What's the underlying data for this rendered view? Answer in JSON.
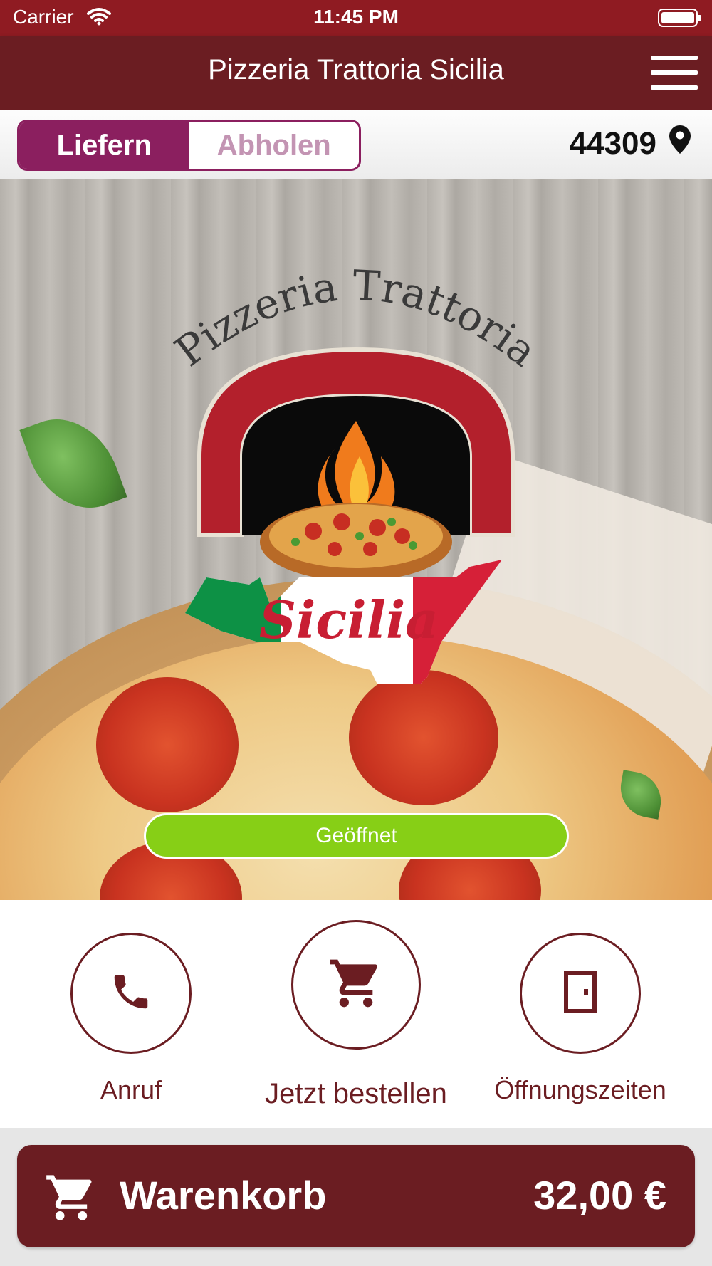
{
  "status_bar": {
    "carrier": "Carrier",
    "time": "11:45 PM"
  },
  "header": {
    "title": "Pizzeria Trattoria Sicilia"
  },
  "order_mode": {
    "deliver_label": "Liefern",
    "pickup_label": "Abholen",
    "active": "Liefern",
    "zip_code": "44309"
  },
  "hero": {
    "logo_text_top": "Pizzeria Trattoria",
    "logo_text_main": "Sicilia",
    "status_label": "Geöffnet"
  },
  "actions": {
    "call_label": "Anruf",
    "order_label": "Jetzt bestellen",
    "hours_label": "Öffnungszeiten"
  },
  "cart": {
    "label": "Warenkorb",
    "total": "32,00 €"
  },
  "colors": {
    "status_bar": "#8f1b22",
    "header": "#6b1d22",
    "segment_accent": "#8b1f5f",
    "open_badge": "#87cf16",
    "cart_bar": "#6b1d22"
  },
  "icons": [
    "wifi-icon",
    "battery-icon",
    "hamburger-menu-icon",
    "location-pin-icon",
    "phone-icon",
    "cart-icon",
    "door-icon"
  ]
}
